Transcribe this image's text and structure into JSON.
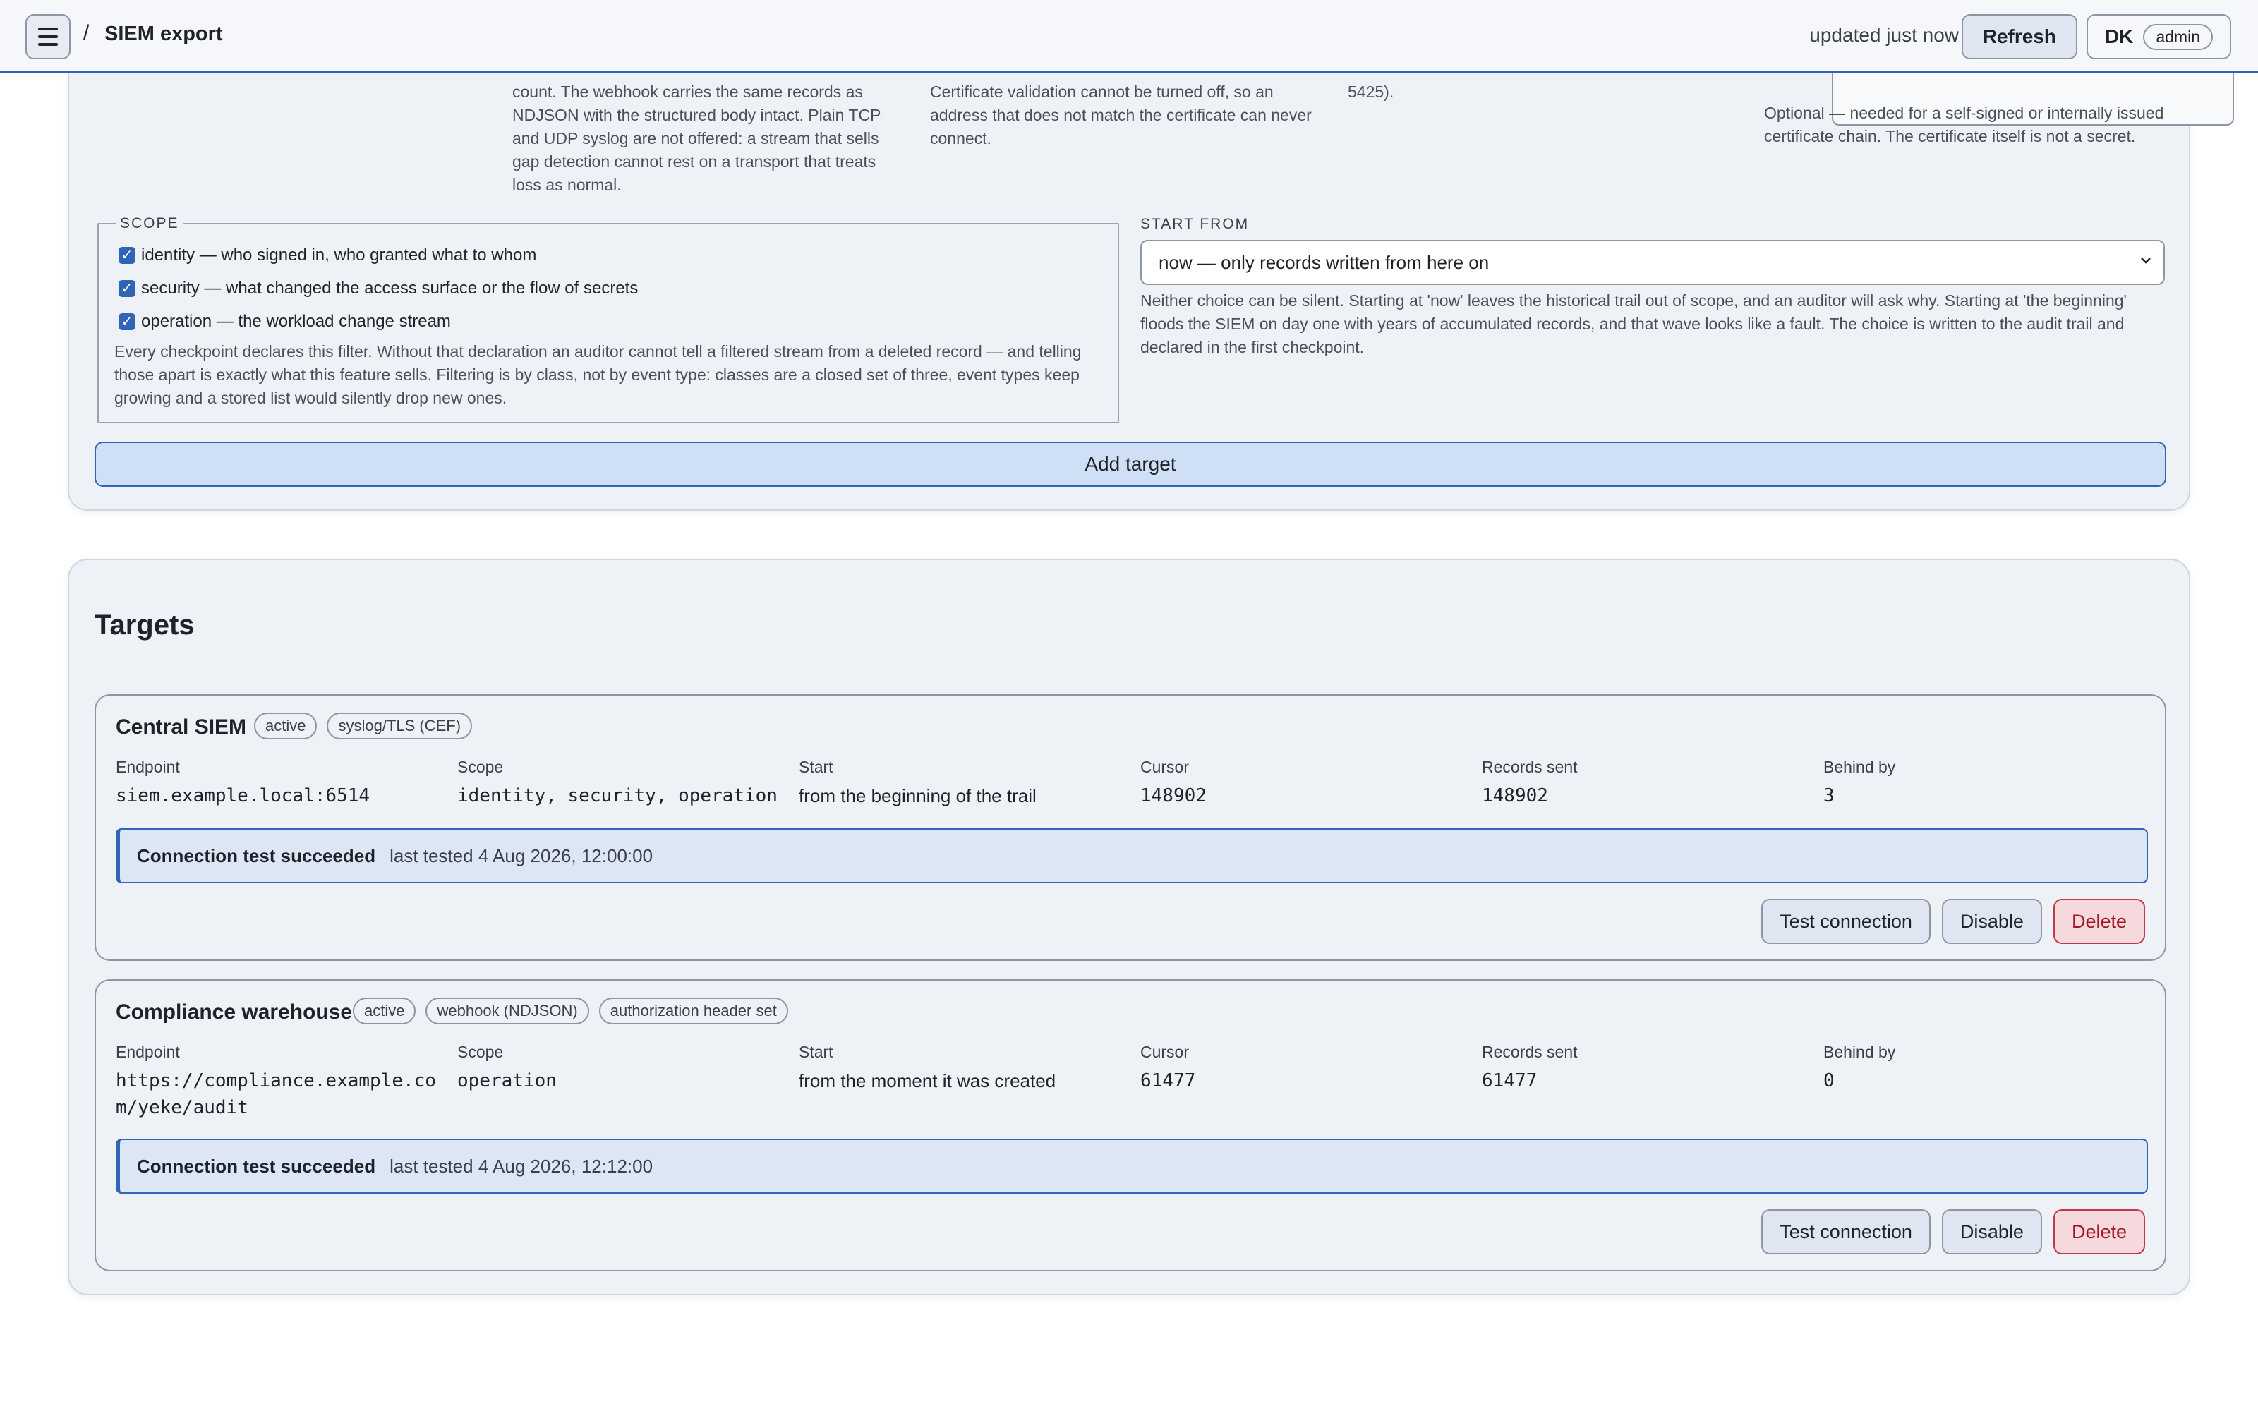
{
  "header": {
    "breadcrumb_separator": "/",
    "title": "SIEM export",
    "updated": "updated just now",
    "refresh_label": "Refresh",
    "user_initials": "DK",
    "user_role": "admin"
  },
  "form": {
    "transport_help": "count. The webhook carries the same records as NDJSON with the structured body intact. Plain TCP and UDP syslog are not offered: a stream that sells gap detection cannot rest on a transport that treats loss as normal.",
    "endpoint_help": "Certificate validation cannot be turned off, so an address that does not match the certificate can never connect.",
    "format_help": "5425).",
    "ca_help": "Optional — needed for a self-signed or internally issued certificate chain. The certificate itself is not a secret.",
    "scope": {
      "legend": "SCOPE",
      "options": [
        {
          "label": "identity — who signed in, who granted what to whom",
          "checked": true
        },
        {
          "label": "security — what changed the access surface or the flow of secrets",
          "checked": true
        },
        {
          "label": "operation — the workload change stream",
          "checked": true
        }
      ],
      "help": "Every checkpoint declares this filter. Without that declaration an auditor cannot tell a filtered stream from a deleted record — and telling those apart is exactly what this feature sells. Filtering is by class, not by event type: classes are a closed set of three, event types keep growing and a stored list would silently drop new ones."
    },
    "start_from": {
      "label": "START FROM",
      "selected": "now — only records written from here on",
      "help": "Neither choice can be silent. Starting at 'now' leaves the historical trail out of scope, and an auditor will ask why. Starting at 'the beginning' floods the SIEM on day one with years of accumulated records, and that wave looks like a fault. The choice is written to the audit trail and declared in the first checkpoint."
    },
    "add_target_label": "Add target"
  },
  "targets": {
    "heading": "Targets",
    "labels": {
      "endpoint": "Endpoint",
      "scope": "Scope",
      "start": "Start",
      "cursor": "Cursor",
      "records_sent": "Records sent",
      "behind_by": "Behind by"
    },
    "items": [
      {
        "name": "Central SIEM",
        "badges": [
          "active",
          "syslog/TLS (CEF)"
        ],
        "endpoint": "siem.example.local:6514",
        "scope": "identity, security, operation",
        "start": "from the beginning of the trail",
        "cursor": "148902",
        "records_sent": "148902",
        "behind_by": "3",
        "conn_title": "Connection test succeeded",
        "conn_time": "last tested 4 Aug 2026, 12:00:00",
        "test_label": "Test connection",
        "disable_label": "Disable",
        "delete_label": "Delete"
      },
      {
        "name": "Compliance warehouse",
        "badges": [
          "active",
          "webhook (NDJSON)",
          "authorization header set"
        ],
        "endpoint_line1": "https://compliance.example.co",
        "endpoint_line2": "m/yeke/audit",
        "scope": "operation",
        "start": "from the moment it was created",
        "cursor": "61477",
        "records_sent": "61477",
        "behind_by": "0",
        "conn_title": "Connection test succeeded",
        "conn_time": "last tested 4 Aug 2026, 12:12:00",
        "test_label": "Test connection",
        "disable_label": "Disable",
        "delete_label": "Delete"
      }
    ]
  }
}
